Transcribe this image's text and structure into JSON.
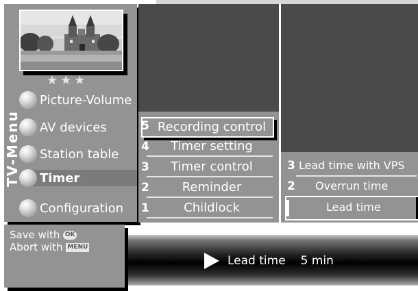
{
  "sidebar": {
    "vertical_title": "TV-Menu",
    "rating_stars": "★★★",
    "items": [
      {
        "label": "Picture-Volume"
      },
      {
        "label": "AV devices"
      },
      {
        "label": "Station table"
      },
      {
        "label": "Timer"
      },
      {
        "label": "Configuration"
      }
    ]
  },
  "timer_submenu": {
    "items": [
      {
        "number": "5",
        "label": "Recording control"
      },
      {
        "number": "4",
        "label": "Timer setting"
      },
      {
        "number": "3",
        "label": "Timer control"
      },
      {
        "number": "2",
        "label": "Reminder"
      },
      {
        "number": "1",
        "label": "Childlock"
      }
    ]
  },
  "recording_submenu": {
    "items": [
      {
        "number": "3",
        "label": "Lead time with VPS"
      },
      {
        "number": "2",
        "label": "Overrun time"
      },
      {
        "number": "",
        "label": "Lead time"
      }
    ]
  },
  "help": {
    "save_prefix": "Save with",
    "ok_key": "OK",
    "abort_prefix": "Abort with",
    "menu_key": "MENU"
  },
  "status": {
    "label": "Lead time",
    "value": "5 min"
  },
  "colors": {
    "panel_gray": "#939393",
    "panel_dark": "#4a4a4a",
    "text": "#ffffff"
  }
}
